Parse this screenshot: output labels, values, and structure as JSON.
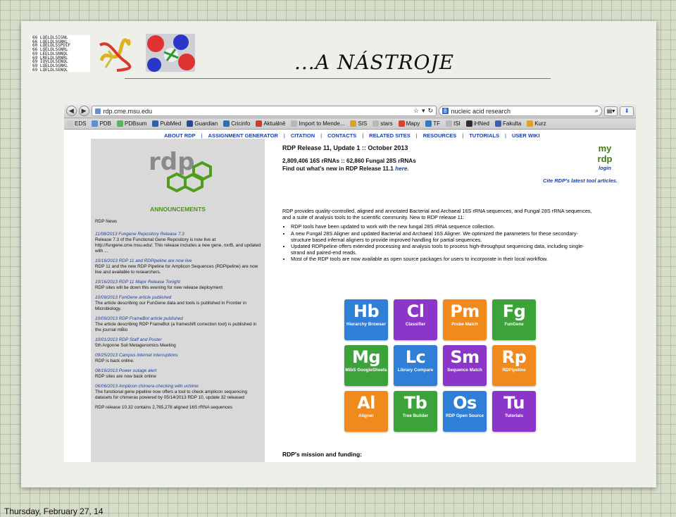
{
  "slide": {
    "title": "...A NÁSTROJE",
    "seq_lines": [
      "66 LQELDLSIGNL",
      "66 LQELDLSGNKL",
      "60 LQELDLSSPDIF",
      "66 LQELDLSGNRL",
      "69 LEELDLSNNQL",
      "69 LRELDLSRNRL",
      "69 IQVLDLSENQL",
      "69 LQELDLSGNKL",
      "69 LQELDLSENQL"
    ],
    "date": "Thursday, February 27, 14"
  },
  "browser": {
    "url": "rdp.cme.msu.edu",
    "search_engine": "8",
    "search_text": "nucleic acid research",
    "bookmarks": [
      {
        "label": "EDS",
        "color": "#c9c9c9"
      },
      {
        "label": "PDB",
        "color": "#5a8fd0"
      },
      {
        "label": "PDBsum",
        "color": "#5ab35a"
      },
      {
        "label": "PubMed",
        "color": "#2b5fb0"
      },
      {
        "label": "Guardian",
        "color": "#1f4b9c"
      },
      {
        "label": "Cricinfo",
        "color": "#2a6fbd"
      },
      {
        "label": "Aktuálně",
        "color": "#d23a2a"
      },
      {
        "label": "Import to Mende...",
        "color": "#b8b8b8"
      },
      {
        "label": "SIS",
        "color": "#e0a020"
      },
      {
        "label": "stars",
        "color": "#b8b8b8"
      },
      {
        "label": "Mapy",
        "color": "#d9452b"
      },
      {
        "label": "TF",
        "color": "#3577c2"
      },
      {
        "label": "ISI",
        "color": "#b8b8b8"
      },
      {
        "label": "iHNed",
        "color": "#2d2d2d"
      },
      {
        "label": "Fakulta",
        "color": "#3a5db8"
      },
      {
        "label": "Kurz",
        "color": "#e0a020"
      }
    ]
  },
  "rdp": {
    "nav": [
      "ABOUT RDP",
      "ASSIGNMENT GENERATOR",
      "CITATION",
      "CONTACTS",
      "RELATED SITES",
      "RESOURCES",
      "TUTORIALS",
      "USER WIKI"
    ],
    "login": {
      "logo": "my rdp",
      "label": "login"
    },
    "release_title": "RDP Release 11, Update 1 :: October 2013",
    "stats_line": "2,809,406 16S rRNAs :: 62,860 Fungal 28S rRNAs",
    "whats_new": "Find out what's new in RDP Release 11.1",
    "whats_new_link": "here.",
    "cite": "Cite RDP's latest tool articles.",
    "intro": "RDP provides quality-controlled, aligned and annotated Bacterial and Archaeal 16S rRNA sequences, and Fungal 28S rRNA sequences, and a suite of analysis tools to the scientific community. New to RDP release 11:",
    "bullets": [
      "RDP tools have been updated to work with the new fungal 28S rRNA sequence collection.",
      "A new Fungal 28S Aligner and updated Bacterial and Archaeal 16S Aligner. We optimized the parameters for these secondary-structure based infernal aligners to provide improved handling for partial sequences.",
      "Updated RDPipeline offers extended processing and analysis tools to process high-throughput sequencing data, including single-strand and paired-end reads.",
      "Most of the RDP tools are now available as open source packages for users to incorporate in their local workflow."
    ],
    "mission": "RDP's mission and funding:",
    "announcements_title": "ANNOUNCEMENTS",
    "news_head": "RDP News",
    "news": [
      {
        "title": "11/08/2013  Fungene Repository Release 7.3",
        "body": "Release 7.3 of the Functional Gene Repository is now live at http://fungene.cme.msu.edu/. This release includes a new gene, nxrB, and updated with ..."
      },
      {
        "title": "10/16/2013  RDP 11 and RDPipeline are now live",
        "body": "RDP 11 and the new RDP Pipeline for Amplicon Sequences (RDPipeline) are now live and available to researchers."
      },
      {
        "title": "10/16/2013  RDP 11 Major Release Tonight",
        "body": "RDP sites will be down this evening for new release deployment"
      },
      {
        "title": "10/09/2013  FunGene article published",
        "body": "The article describing our FunGene data and tools is published in Frontier in Microbiology."
      },
      {
        "title": "10/09/2013  RDP FrameBot article published",
        "body": "The article describing RDP FrameBot (a frameshift correction tool) is published in the journal mBio"
      },
      {
        "title": "10/01/2013  RDP Staff and Poster",
        "body": "5th Argonne Soil Metagenomics Meeting"
      },
      {
        "title": "09/25/2013  Campus internet interruptions",
        "body": "RDP is back online."
      },
      {
        "title": "08/16/2013  Power outage alert",
        "body": "RDP sites are now back online"
      },
      {
        "title": "06/06/2013  Amplicon chimera checking with uchime",
        "body": "The functional gene pipeline now offers a tool to check amplicon sequencing datasets for chimeras powered by 05/14/2013  RDP 10, update 32 released"
      },
      {
        "title": "",
        "body": "RDP release 10.32 contains 2,765,278 aligned 16S rRNA sequences"
      }
    ],
    "tiles": [
      {
        "sym": "Hb",
        "name": "Hierarchy Browser",
        "color": "#2f7fd6"
      },
      {
        "sym": "Cl",
        "name": "Classifier",
        "color": "#8a37c9"
      },
      {
        "sym": "Pm",
        "name": "Probe Match",
        "color": "#f08a1c"
      },
      {
        "sym": "Fg",
        "name": "FunGene",
        "color": "#3ca23a"
      },
      {
        "sym": "Mg",
        "name": "MibS GoogleSheets",
        "color": "#3ca23a"
      },
      {
        "sym": "Lc",
        "name": "Library Compare",
        "color": "#2f7fd6"
      },
      {
        "sym": "Sm",
        "name": "Sequence Match",
        "color": "#8a37c9"
      },
      {
        "sym": "Rp",
        "name": "RDPipeline",
        "color": "#f08a1c"
      },
      {
        "sym": "Al",
        "name": "Aligner",
        "color": "#f08a1c"
      },
      {
        "sym": "Tb",
        "name": "Tree Builder",
        "color": "#3ca23a"
      },
      {
        "sym": "Os",
        "name": "RDP Open Source",
        "color": "#2f7fd6"
      },
      {
        "sym": "Tu",
        "name": "Tutorials",
        "color": "#8a37c9"
      }
    ]
  }
}
